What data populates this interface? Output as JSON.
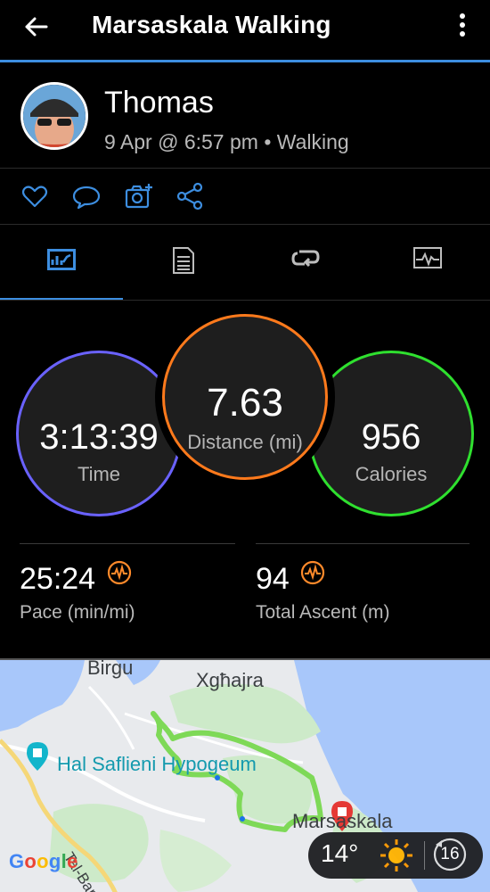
{
  "app_bar": {
    "title": "Marsaskala Walking"
  },
  "profile": {
    "name": "Thomas",
    "meta": "9 Apr @ 6:57 pm • Walking"
  },
  "actions": [
    "heart-icon",
    "comment-icon",
    "add-photo-icon",
    "share-icon"
  ],
  "tabs": [
    {
      "icon": "stats-chart-icon",
      "active": true
    },
    {
      "icon": "details-list-icon",
      "active": false
    },
    {
      "icon": "laps-loop-icon",
      "active": false
    },
    {
      "icon": "graph-monitor-icon",
      "active": false
    }
  ],
  "summary": {
    "time": {
      "value": "3:13:39",
      "label": "Time",
      "color": "#6a62ff"
    },
    "distance": {
      "value": "7.63",
      "label": "Distance (mi)",
      "color": "#ff7a1c"
    },
    "calories": {
      "value": "956",
      "label": "Calories",
      "color": "#2fe02f"
    }
  },
  "stats": {
    "pace": {
      "value": "25:24",
      "label": "Pace (min/mi)",
      "icon": "pace-chart-icon"
    },
    "ascent": {
      "value": "94",
      "label": "Total Ascent (m)",
      "icon": "ascent-chart-icon"
    }
  },
  "map": {
    "places": [
      "Birgu",
      "Xgħajra",
      "Hal Saflieni Hypogeum",
      "Marsaskala",
      "Tal-Barrani"
    ],
    "route_color": "#7ed957",
    "weather": {
      "temp": "14°",
      "wind": "16"
    },
    "attribution": "Google"
  }
}
